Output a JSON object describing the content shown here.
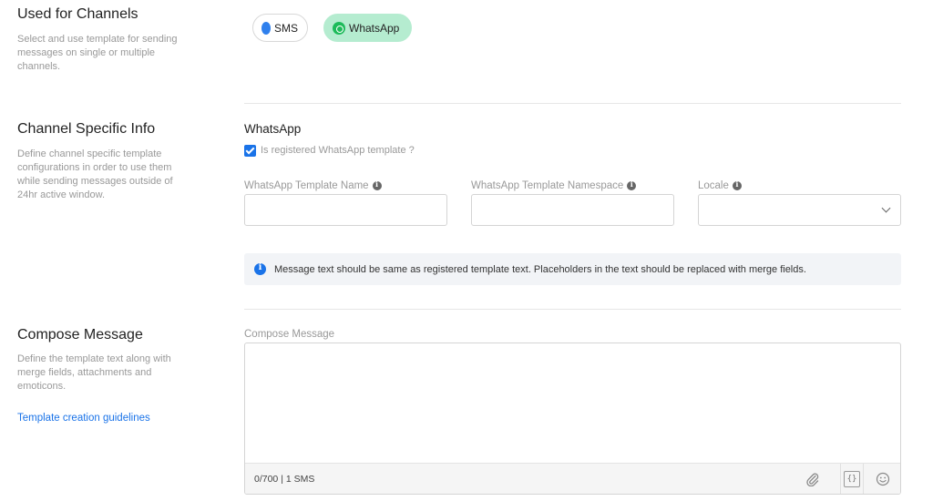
{
  "sections": {
    "channels": {
      "title": "Used for Channels",
      "description": "Select and use template for sending messages on single or multiple channels."
    },
    "channel_info": {
      "title": "Channel Specific Info",
      "description": "Define channel specific template configurations in order to use them while sending messages outside of 24hr active window."
    },
    "compose": {
      "title": "Compose Message",
      "description": "Define the template text along with merge fields, attachments and emoticons.",
      "link": "Template creation guidelines"
    }
  },
  "channels": [
    {
      "label": "SMS",
      "icon": "sms-bubble-icon",
      "selected": false
    },
    {
      "label": "WhatsApp",
      "icon": "whatsapp-icon",
      "selected": true
    }
  ],
  "whatsapp": {
    "heading": "WhatsApp",
    "registered_label": "Is registered WhatsApp template ?",
    "registered": true,
    "fields": {
      "template_name": {
        "label": "WhatsApp Template Name",
        "value": ""
      },
      "namespace": {
        "label": "WhatsApp Template Namespace",
        "value": ""
      },
      "locale": {
        "label": "Locale",
        "value": ""
      }
    },
    "info": "Message text should be same as registered template text. Placeholders in the text should be replaced with merge fields."
  },
  "compose": {
    "label": "Compose Message",
    "value": "",
    "counter": "0/700 | 1 SMS"
  },
  "colors": {
    "accent": "#1a73e8",
    "whatsapp_chip_bg": "#b5ecd0",
    "whatsapp_green": "#1dbb5a"
  }
}
